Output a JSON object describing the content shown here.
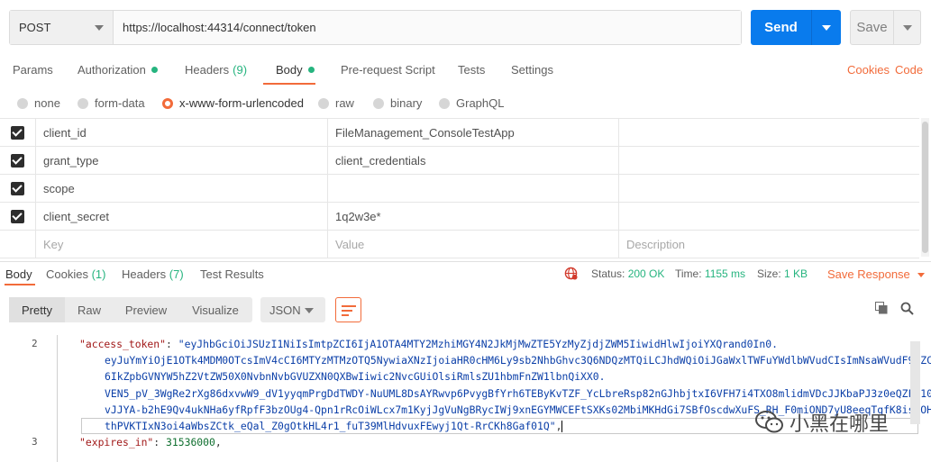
{
  "request": {
    "method": "POST",
    "url": "https://localhost:44314/connect/token",
    "send_label": "Send",
    "save_label": "Save"
  },
  "request_tabs": {
    "params": "Params",
    "authorization": "Authorization",
    "headers": "Headers",
    "headers_count": "(9)",
    "body": "Body",
    "pre_request": "Pre-request Script",
    "tests": "Tests",
    "settings": "Settings",
    "cookies": "Cookies",
    "code": "Code"
  },
  "body_types": {
    "none": "none",
    "form_data": "form-data",
    "urlencoded": "x-www-form-urlencoded",
    "raw": "raw",
    "binary": "binary",
    "graphql": "GraphQL",
    "selected": "x-www-form-urlencoded"
  },
  "params": {
    "rows": [
      {
        "key": "client_id",
        "value": "FileManagement_ConsoleTestApp",
        "checked": true
      },
      {
        "key": "grant_type",
        "value": "client_credentials",
        "checked": true
      },
      {
        "key": "scope",
        "value": "",
        "checked": true
      },
      {
        "key": "client_secret",
        "value": "1q2w3e*",
        "checked": true
      }
    ],
    "placeholder_key": "Key",
    "placeholder_value": "Value",
    "placeholder_desc": "Description"
  },
  "response_tabs": {
    "body": "Body",
    "cookies": "Cookies",
    "cookies_count": "(1)",
    "headers": "Headers",
    "headers_count": "(7)",
    "test_results": "Test Results"
  },
  "response_status": {
    "status_label": "Status:",
    "status_value": "200 OK",
    "time_label": "Time:",
    "time_value": "1155 ms",
    "size_label": "Size:",
    "size_value": "1 KB",
    "save_response": "Save Response"
  },
  "response_view": {
    "pretty": "Pretty",
    "raw": "Raw",
    "preview": "Preview",
    "visualize": "Visualize",
    "format": "JSON"
  },
  "code": {
    "line2_num": "2",
    "line3_num": "3",
    "access_token_key": "\"access_token\"",
    "token_part1": "\"eyJhbGciOiJSUzI1NiIsImtpZCI6IjA1OTA4MTY2MzhiMGY4N2JkMjMwZTE5YzMyZjdjZWM5IiwidHlwIjoiYXQrand0In0.",
    "token_part2": "eyJuYmYiOjE1OTk4MDM0OTcsImV4cCI6MTYzMTMzOTQ5NywiaXNzIjoiaHR0cHM6Ly9sb2NhbGhvc3Q6NDQzMTQiLCJhdWQiOiJGaWxlTWFuYWdlbWVudCIsImNsaWVudF9pZCI",
    "token_part3": "6IkZpbGVNYW5hZ2VtZW50X0NvbnNvbGVUZXN0QXBwIiwic2NvcGUiOlsiRmlsZU1hbmFnZW1lbnQiXX0.",
    "token_part4": "VEN5_pV_3WgRe2rXg86dxvwW9_dV1yyqmPrgDdTWDY-NuUML8DsAYRwvp6PvygBfYrh6TEByKvTZF_YcLbreRsp82nGJhbjtxI6VFH7i4TXO8mlidmVDcJJKbaPJ3z0eQZFH10I",
    "token_part5": "vJJYA-b2hE9Qv4ukNHa6yfRpfF3bzOUg4-Qpn1rRcOiWLcx7m1KyjJgVuNgBRycIWj9xnEGYMWCEFtSXKs02MbiMKHdGi7SBfOscdwXuFS_RH_F0miOND7yU8eeqTqfK8isIOH",
    "token_part6": "thPVKTIxN3oi4aWbsZCtk_eQal_Z0gOtkHL4r1_fuT39MlHdvuxFEwyj1Qt-RrCKh8Gaf01Q\"",
    "expires_key": "\"expires_in\"",
    "expires_value": "31536000"
  },
  "watermark": {
    "text": "小黑在哪里"
  },
  "colors": {
    "accent": "#f26b3a",
    "send": "#097bed",
    "success": "#26b47f"
  }
}
